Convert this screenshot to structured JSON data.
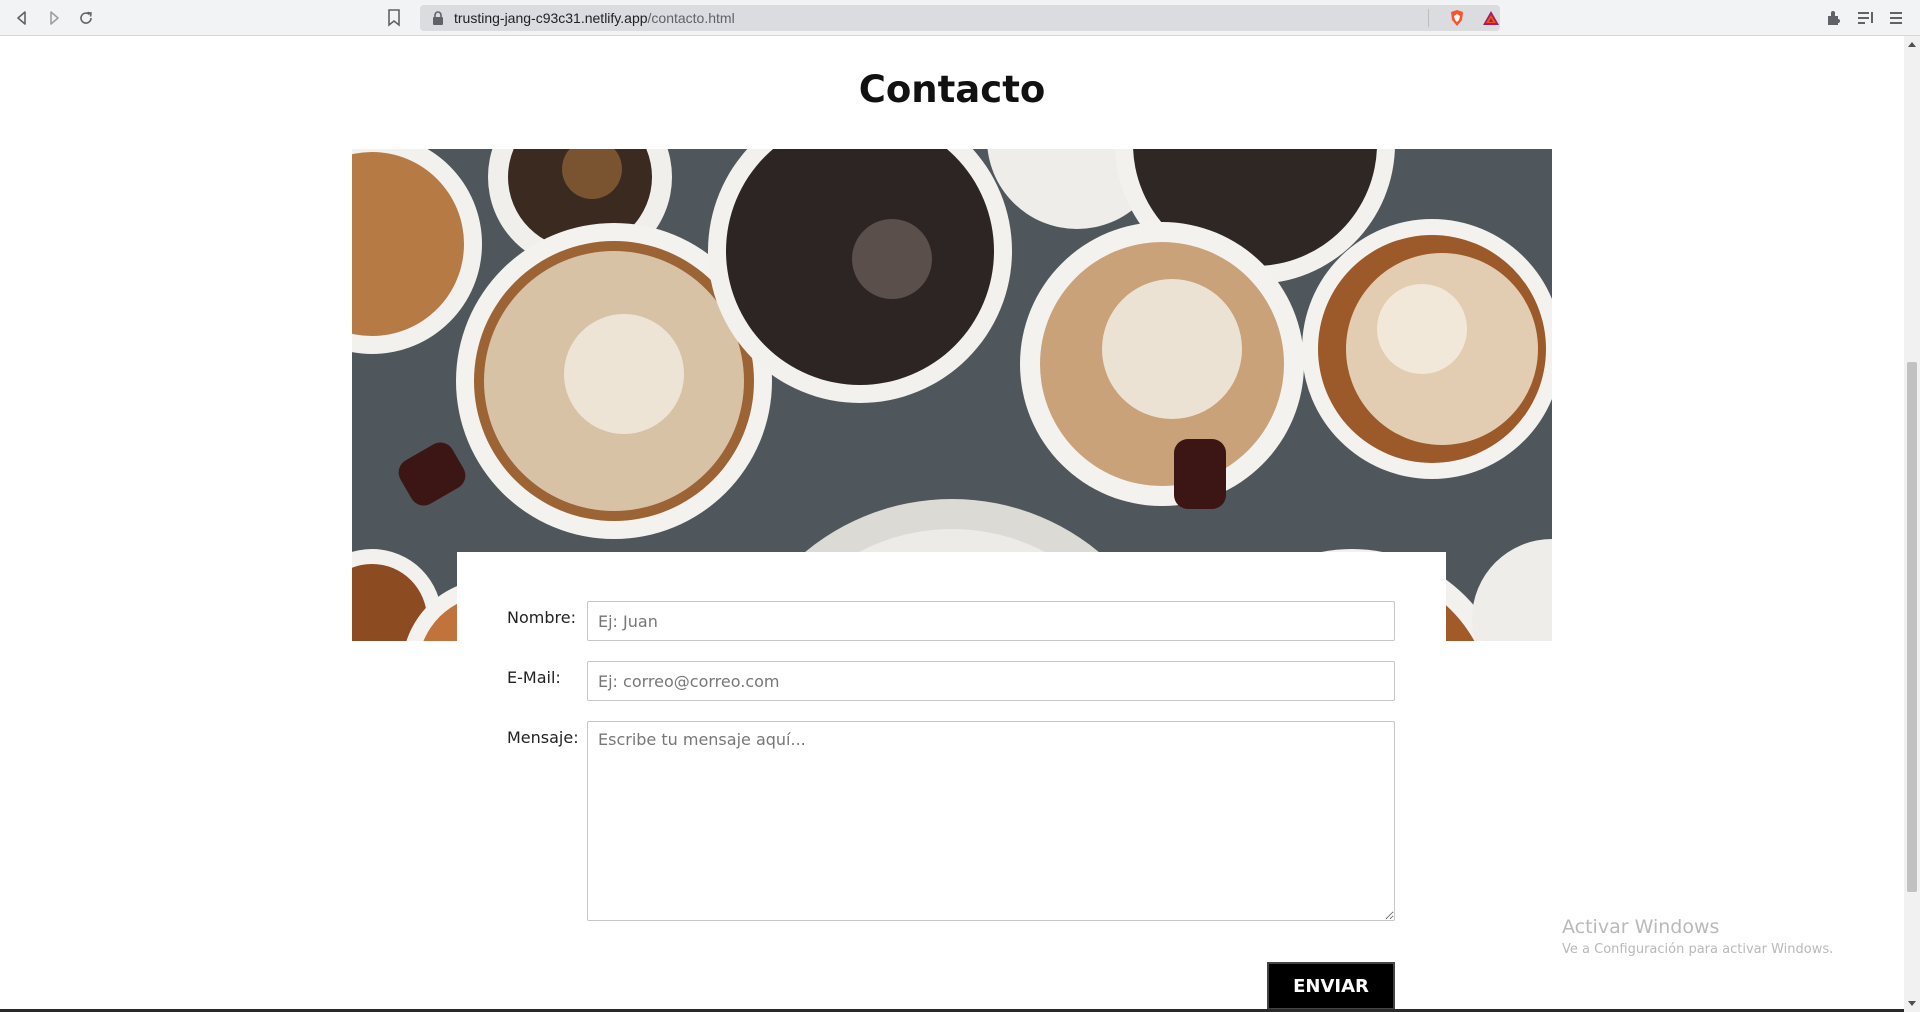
{
  "browser": {
    "url_host": "trusting-jang-c93c31.netlify.app",
    "url_path": "/contacto.html",
    "icons": [
      "back-icon",
      "forward-icon",
      "reload-icon",
      "bookmark-icon",
      "lock-icon",
      "brave-shield-icon",
      "brave-rewards-icon",
      "extensions-icon",
      "reading-list-icon",
      "menu-icon"
    ]
  },
  "page": {
    "title": "Contacto"
  },
  "form": {
    "name_label": "Nombre:",
    "name_placeholder": "Ej: Juan",
    "email_label": "E-Mail:",
    "email_placeholder": "Ej: correo@correo.com",
    "message_label": "Mensaje:",
    "message_placeholder": "Escribe tu mensaje aquí...",
    "submit_label": "ENVIAR"
  },
  "watermark": {
    "line1": "Activar Windows",
    "line2": "Ve a Configuración para activar Windows."
  },
  "colors": {
    "button_bg": "#000000",
    "hero_bg": "#4b5358"
  }
}
